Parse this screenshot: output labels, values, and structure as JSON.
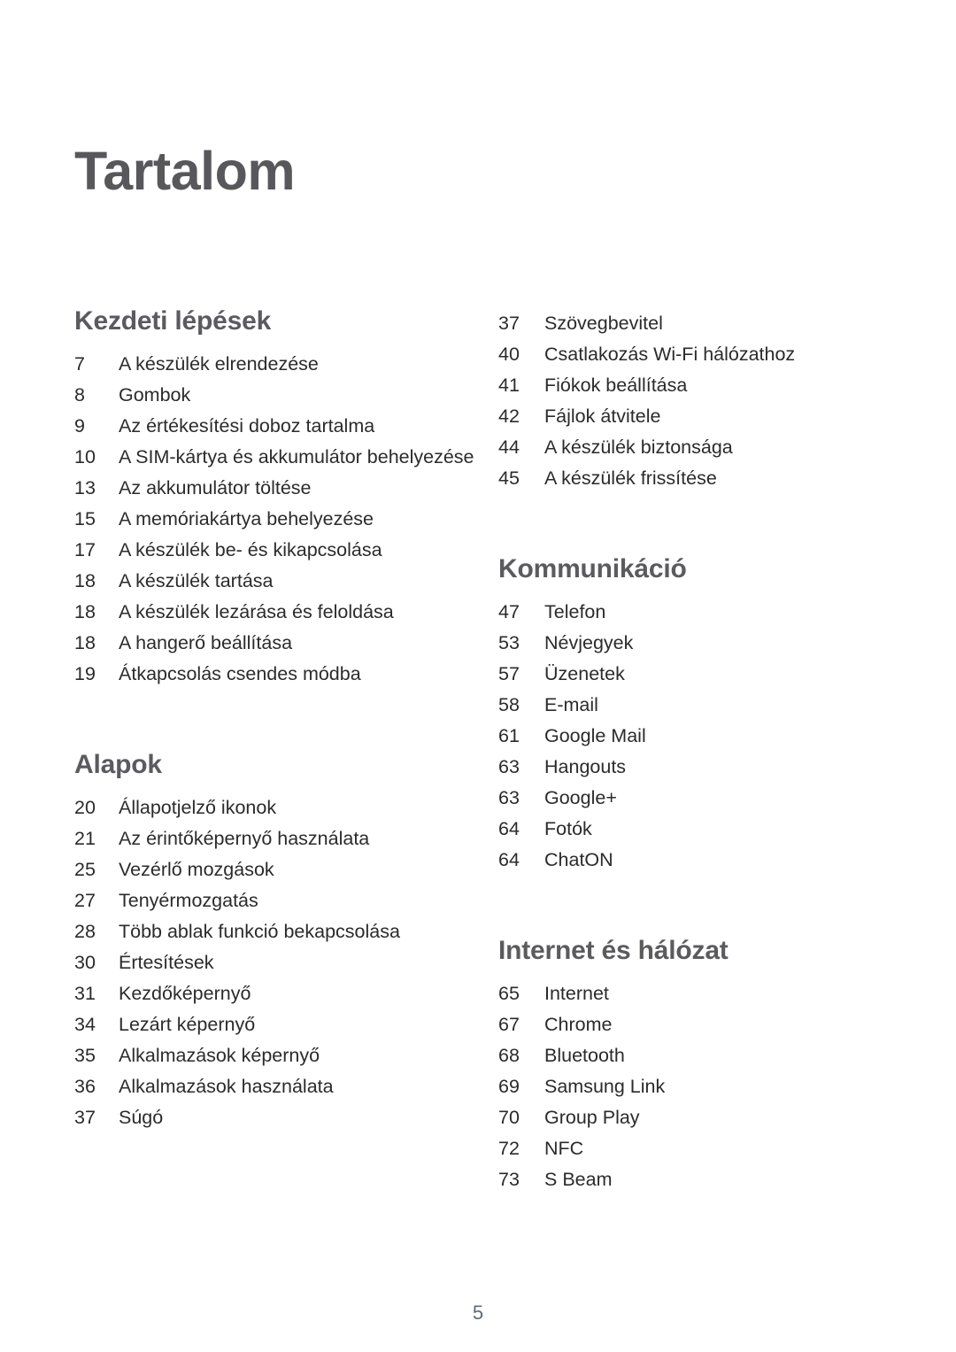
{
  "document": {
    "title": "Tartalom",
    "page_number": "5",
    "colors": {
      "heading": "#5b5b5f",
      "body": "#2b2b2b",
      "page_number": "#5f6b73",
      "background": "#ffffff"
    }
  },
  "columns": {
    "left": [
      {
        "heading": "Kezdeti lépések",
        "entries": [
          {
            "page": "7",
            "title": "A készülék elrendezése"
          },
          {
            "page": "8",
            "title": "Gombok"
          },
          {
            "page": "9",
            "title": "Az értékesítési doboz tartalma"
          },
          {
            "page": "10",
            "title": "A SIM-kártya és akkumulátor behelyezése"
          },
          {
            "page": "13",
            "title": "Az akkumulátor töltése"
          },
          {
            "page": "15",
            "title": "A memóriakártya behelyezése"
          },
          {
            "page": "17",
            "title": "A készülék be- és kikapcsolása"
          },
          {
            "page": "18",
            "title": "A készülék tartása"
          },
          {
            "page": "18",
            "title": "A készülék lezárása és feloldása"
          },
          {
            "page": "18",
            "title": "A hangerő beállítása"
          },
          {
            "page": "19",
            "title": "Átkapcsolás csendes módba"
          }
        ]
      },
      {
        "heading": "Alapok",
        "entries": [
          {
            "page": "20",
            "title": "Állapotjelző ikonok"
          },
          {
            "page": "21",
            "title": "Az érintőképernyő használata"
          },
          {
            "page": "25",
            "title": "Vezérlő mozgások"
          },
          {
            "page": "27",
            "title": "Tenyérmozgatás"
          },
          {
            "page": "28",
            "title": "Több ablak funkció bekapcsolása"
          },
          {
            "page": "30",
            "title": "Értesítések"
          },
          {
            "page": "31",
            "title": "Kezdőképernyő"
          },
          {
            "page": "34",
            "title": "Lezárt képernyő"
          },
          {
            "page": "35",
            "title": "Alkalmazások képernyő"
          },
          {
            "page": "36",
            "title": "Alkalmazások használata"
          },
          {
            "page": "37",
            "title": "Súgó"
          }
        ]
      }
    ],
    "right": [
      {
        "heading": "",
        "entries": [
          {
            "page": "37",
            "title": "Szövegbevitel"
          },
          {
            "page": "40",
            "title": "Csatlakozás Wi-Fi hálózathoz"
          },
          {
            "page": "41",
            "title": "Fiókok beállítása"
          },
          {
            "page": "42",
            "title": "Fájlok átvitele"
          },
          {
            "page": "44",
            "title": "A készülék biztonsága"
          },
          {
            "page": "45",
            "title": "A készülék frissítése"
          }
        ]
      },
      {
        "heading": "Kommunikáció",
        "entries": [
          {
            "page": "47",
            "title": "Telefon"
          },
          {
            "page": "53",
            "title": "Névjegyek"
          },
          {
            "page": "57",
            "title": "Üzenetek"
          },
          {
            "page": "58",
            "title": "E-mail"
          },
          {
            "page": "61",
            "title": "Google Mail"
          },
          {
            "page": "63",
            "title": "Hangouts"
          },
          {
            "page": "63",
            "title": "Google+"
          },
          {
            "page": "64",
            "title": "Fotók"
          },
          {
            "page": "64",
            "title": "ChatON"
          }
        ]
      },
      {
        "heading": "Internet és hálózat",
        "entries": [
          {
            "page": "65",
            "title": "Internet"
          },
          {
            "page": "67",
            "title": "Chrome"
          },
          {
            "page": "68",
            "title": "Bluetooth"
          },
          {
            "page": "69",
            "title": "Samsung Link"
          },
          {
            "page": "70",
            "title": "Group Play"
          },
          {
            "page": "72",
            "title": "NFC"
          },
          {
            "page": "73",
            "title": "S Beam"
          }
        ]
      }
    ]
  }
}
